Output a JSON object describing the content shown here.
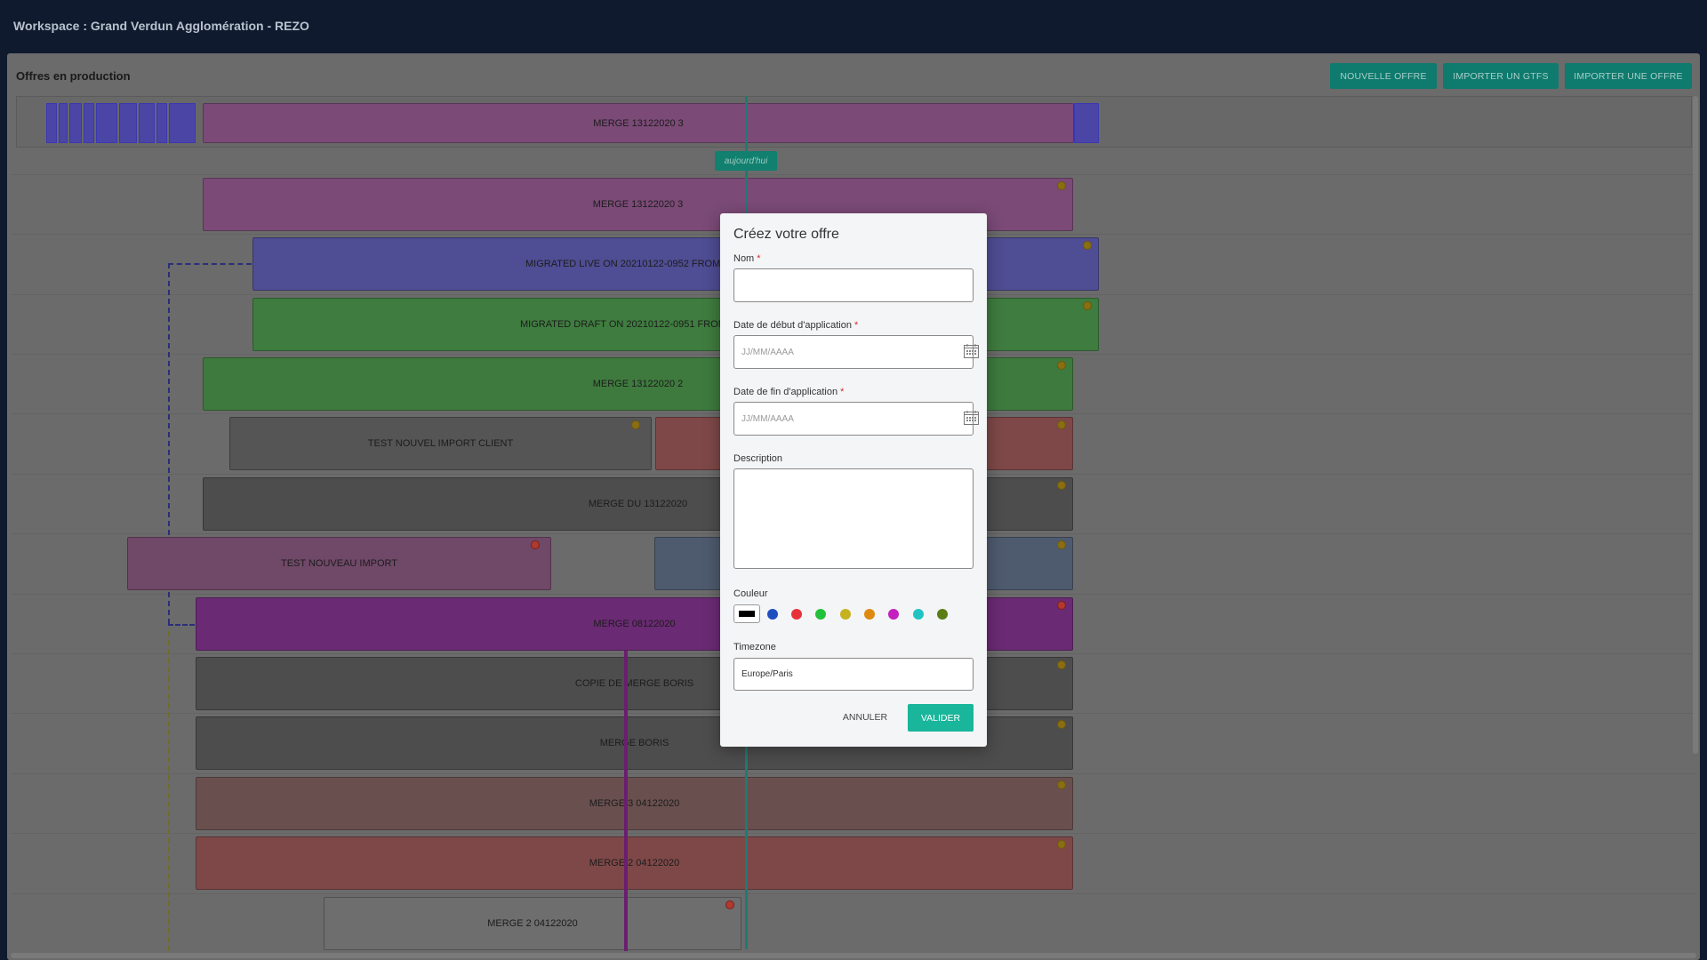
{
  "workspace": {
    "title": "Workspace : Grand Verdun Agglomération - REZO"
  },
  "panel": {
    "title": "Offres en production",
    "buttons": {
      "new_offer": "NOUVELLE OFFRE",
      "import_gtfs": "IMPORTER UN GTFS",
      "import_offer": "IMPORTER UNE OFFRE"
    }
  },
  "timeline": {
    "today_label": "aujourd'hui",
    "merged_label": "MERGE 13122020 3",
    "rows": [
      {
        "label": "MERGE 13122020 3",
        "color": "#7b4a77"
      },
      {
        "label": "MIGRATED LIVE ON 20210122-0952 FROM",
        "color": "#4f4d93"
      },
      {
        "label": "MIGRATED DRAFT ON 20210122-0951 FROM",
        "color": "#3f7c3f"
      },
      {
        "label": "MERGE 13122020 2",
        "color": "#3e7a3e"
      },
      {
        "label": "TEST NOUVEL IMPORT CLIENT",
        "color": "#555555"
      },
      {
        "label": "MERGE DU 13122020",
        "color": "#4d4d4d"
      },
      {
        "label": "TEST NOUVEAU IMPORT",
        "color": "#704868"
      },
      {
        "label": "MERGE 08122020",
        "color": "#6b2a74"
      },
      {
        "label": "COPIE DE MERGE BORIS",
        "color": "#4d4d4d"
      },
      {
        "label": "MERGE BORIS",
        "color": "#4d4d4d"
      },
      {
        "label": "MERGE 3 04122020",
        "color": "#6a4f4f"
      },
      {
        "label": "MERGE 2 04122020",
        "color": "#7e4848"
      },
      {
        "label": "MERGE 2 04122020",
        "color": "#6e6e6e"
      }
    ]
  },
  "modal": {
    "title": "Créez votre offre",
    "name_label": "Nom",
    "required_mark": "*",
    "start_label": "Date de début d'application",
    "end_label": "Date de fin d'application",
    "date_placeholder": "JJ/MM/AAAA",
    "description_label": "Description",
    "color_label": "Couleur",
    "colors": [
      "#000000",
      "#1f4fbf",
      "#e8323a",
      "#22c13b",
      "#c6b21e",
      "#de8a12",
      "#c41fbf",
      "#21c4c2",
      "#5a7d14"
    ],
    "timezone_label": "Timezone",
    "timezone_value": "Europe/Paris",
    "cancel_label": "ANNULER",
    "submit_label": "VALIDER"
  }
}
